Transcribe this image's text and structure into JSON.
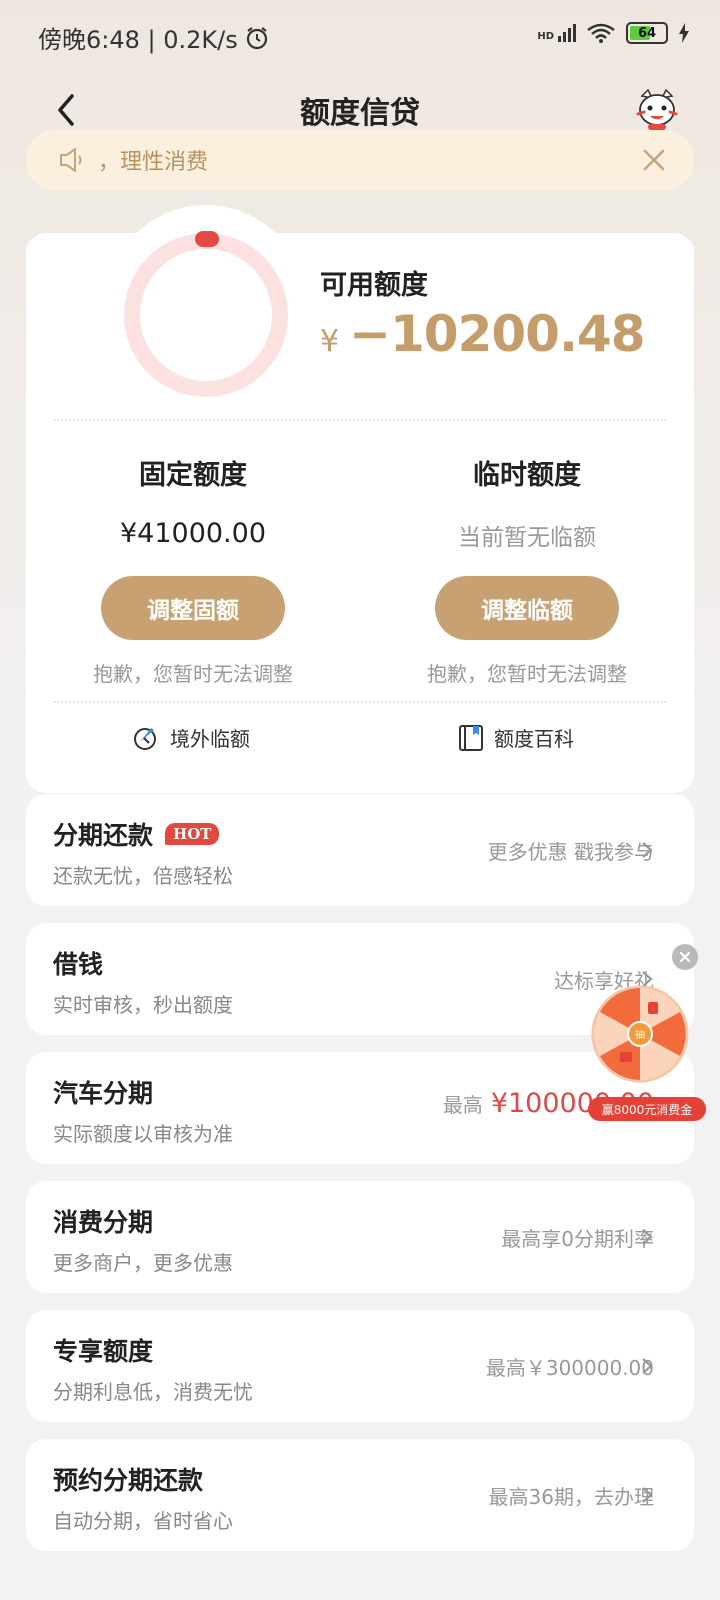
{
  "status_bar": {
    "time": "傍晚6:48 | 0.2K/s",
    "network": "HD",
    "battery": "64",
    "battery_level": 0.64
  },
  "header": {
    "title": "额度信贷",
    "back_icon": "chevron-left-icon",
    "mascot_icon": "mascot-icon"
  },
  "notice": {
    "text": "，理性消费",
    "icon": "speaker-icon",
    "close_icon": "close-icon"
  },
  "credit": {
    "available_label": "可用额度",
    "currency": "¥",
    "available_value": "−10200.48",
    "ring_color": "#e44a45",
    "ring_track_color": "#fbe2e1",
    "fixed": {
      "title": "固定额度",
      "value": "¥41000.00",
      "button": "调整固额",
      "note": "抱歉，您暂时无法调整"
    },
    "temporary": {
      "title": "临时额度",
      "value": "当前暂无临额",
      "button": "调整临额",
      "note": "抱歉，您暂时无法调整"
    },
    "links": {
      "overseas": "境外临额",
      "wiki": "额度百科"
    }
  },
  "menu": [
    {
      "title": "分期还款",
      "badge": "HOT",
      "subtitle": "还款无忧，倍感轻松",
      "right": "更多优惠 戳我参与"
    },
    {
      "title": "借钱",
      "subtitle": "实时审核，秒出额度",
      "right": "达标享好礼"
    },
    {
      "title": "汽车分期",
      "subtitle": "实际额度以审核为准",
      "right_prefix": "最高",
      "right_price": "¥100000.00"
    },
    {
      "title": "消费分期",
      "subtitle": "更多商户，更多优惠",
      "right": "最高享0分期利率"
    },
    {
      "title": "专享额度",
      "subtitle": "分期利息低，消费无忧",
      "right": "最高￥300000.00"
    },
    {
      "title": "预约分期还款",
      "subtitle": "自动分期，省时省心",
      "right": "最高36期，去办理"
    }
  ],
  "floating": {
    "label": "赢8000元消费金",
    "wheel_center": "抽",
    "accent": "#e54237"
  },
  "colors": {
    "gold": "#c8a173",
    "red": "#e04848"
  }
}
